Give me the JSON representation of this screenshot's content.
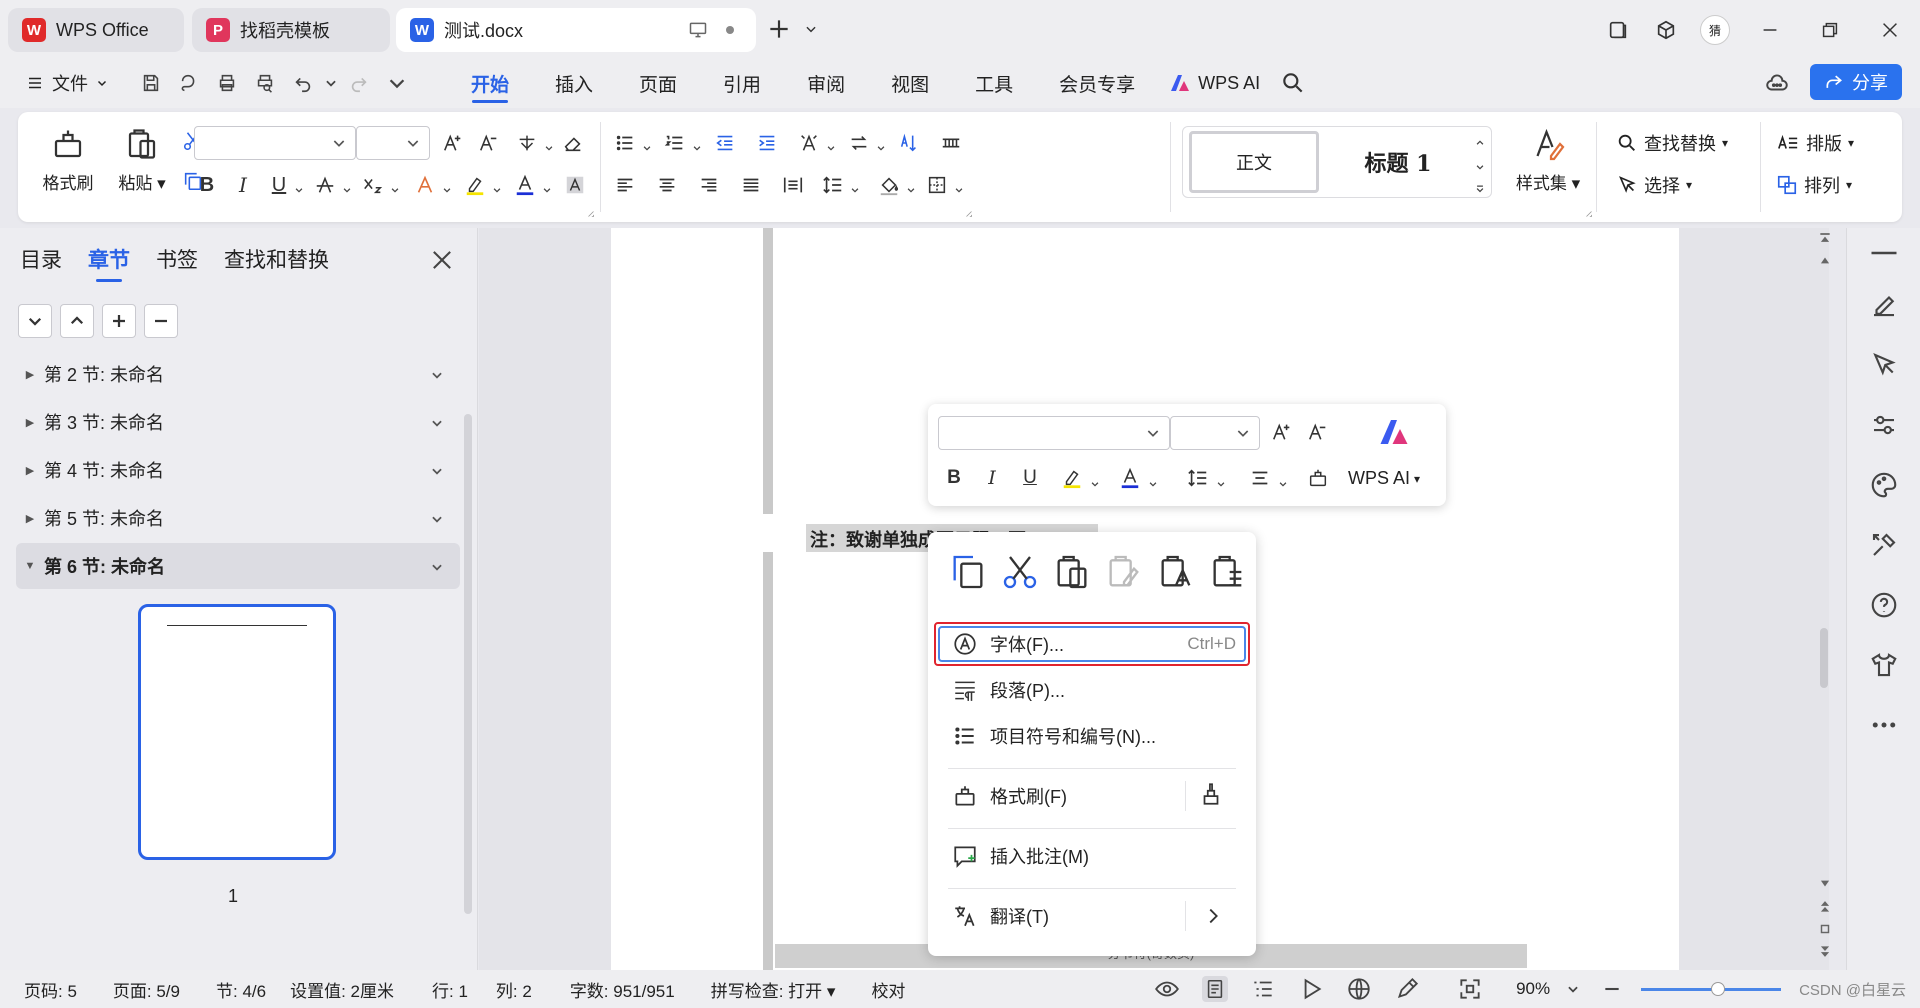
{
  "titlebar": {
    "tabs": [
      {
        "label": "WPS Office",
        "logo": "W",
        "color": "#e02a2a"
      },
      {
        "label": "找稻壳模板",
        "logo": "P",
        "color": "#e0365c"
      },
      {
        "label": "测试.docx",
        "logo": "W",
        "color": "#2a62e6"
      }
    ],
    "avatar_text": "猜"
  },
  "menubar": {
    "file_label": "文件",
    "tabs": [
      "开始",
      "插入",
      "页面",
      "引用",
      "审阅",
      "视图",
      "工具",
      "会员专享"
    ],
    "active_tab": "开始",
    "wps_ai": "WPS AI",
    "share": "分享"
  },
  "ribbon": {
    "format_painter": "格式刷",
    "paste": "粘贴",
    "style_normal": "正文",
    "style_heading1": "标题 1",
    "styles_set": "样式集",
    "find_replace": "查找替换",
    "select": "选择",
    "layout": "排版",
    "arrange": "排列",
    "bold": "B",
    "italic": "I",
    "underline": "U"
  },
  "navpanel": {
    "tabs": [
      "目录",
      "章节",
      "书签",
      "查找和替换"
    ],
    "active_tab": "章节",
    "sections": [
      {
        "label": "第 2 节: 未命名",
        "selected": false
      },
      {
        "label": "第 3 节: 未命名",
        "selected": false
      },
      {
        "label": "第 4 节: 未命名",
        "selected": false
      },
      {
        "label": "第 5 节: 未命名",
        "selected": false
      },
      {
        "label": "第 6 节: 未命名",
        "selected": true
      }
    ],
    "thumb_page_number": "1"
  },
  "document": {
    "note_text": "注：致谢单独成页只限一页",
    "section_break": "分节符(奇数页)"
  },
  "mini_toolbar": {
    "bold": "B",
    "italic": "I",
    "underline": "U",
    "wps_ai": "WPS AI"
  },
  "context_menu": {
    "items": [
      {
        "label": "字体(F)...",
        "shortcut": "Ctrl+D",
        "icon": "font-circle-icon"
      },
      {
        "label": "段落(P)...",
        "shortcut": "",
        "icon": "paragraph-icon"
      },
      {
        "label": "项目符号和编号(N)...",
        "shortcut": "",
        "icon": "bullet-list-icon"
      },
      {
        "label": "格式刷(F)",
        "shortcut": "",
        "icon": "format-painter-icon"
      },
      {
        "label": "插入批注(M)",
        "shortcut": "",
        "icon": "comment-icon"
      },
      {
        "label": "翻译(T)",
        "shortcut": "",
        "icon": "translate-icon"
      }
    ],
    "highlighted": "字体(F)..."
  },
  "statusbar": {
    "page_code": "页码: 5",
    "page": "页面: 5/9",
    "section": "节: 4/6",
    "setting": "设置值: 2厘米",
    "row": "行: 1",
    "col": "列: 2",
    "word_count": "字数: 951/951",
    "spell_check": "拼写检查: 打开",
    "proofread": "校对",
    "zoom": "90%",
    "watermark": "CSDN @白星云"
  },
  "colors": {
    "accent": "#2a62e6",
    "highlight_border": "#e0242e",
    "share_button": "#2a72ee"
  }
}
